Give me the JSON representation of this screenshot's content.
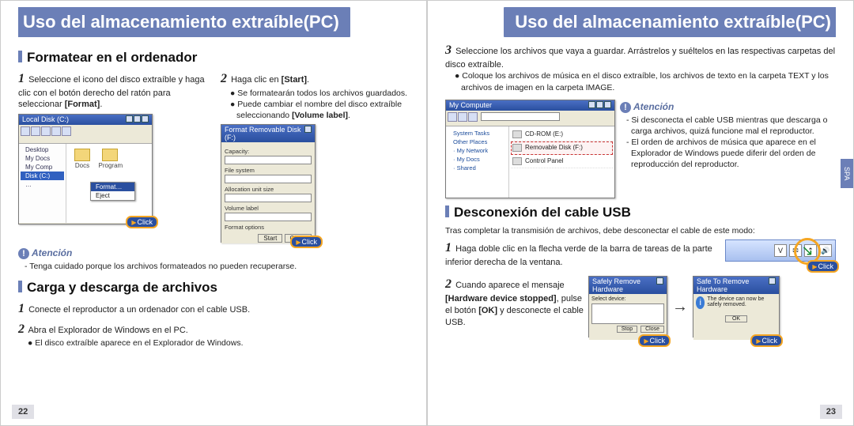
{
  "page_left": {
    "title": "Uso del almacenamiento extraíble(PC)",
    "number": "22",
    "section_format": {
      "heading": "Formatear en el ordenador",
      "step1_prefix": "1",
      "step1": "Seleccione el icono del disco extraíble y haga clic con el botón derecho del ratón para seleccionar ",
      "step1_bold": "[Format]",
      "step1_after": ".",
      "step2_prefix": "2",
      "step2": "Haga clic en ",
      "step2_bold": "[Start]",
      "step2_after": ".",
      "step2_b1": "● Se formatearán todos los archivos guardados.",
      "step2_b2a": "● Puede cambiar el nombre del disco extraíble seleccionando ",
      "step2_b2_bold": "[Volume label]",
      "step2_b2b": ".",
      "atencion": "Atención",
      "aten_line": "- Tenga cuidado porque los archivos formateados no pueden recuperarse."
    },
    "section_cargadescarga": {
      "heading": "Carga y descarga de archivos",
      "step1_prefix": "1",
      "step1": "Conecte el reproductor a un ordenador con el cable USB.",
      "step2_prefix": "2",
      "step2": "Abra el Explorador de Windows en el PC.",
      "step2_b1": "● El disco extraíble aparece en el Explorador de Windows."
    },
    "screenshots": {
      "explorer_title": "Local Disk (C:)",
      "ctx_item_hi": "Format…",
      "ctx_item_2": "Eject",
      "click": "Click",
      "formatdlg_title": "Format  Removable Disk (F:)",
      "lbl_capacity": "Capacity:",
      "lbl_filesystem": "File system",
      "lbl_alloc": "Allocation unit size",
      "lbl_volume": "Volume label",
      "lbl_options": "Format options",
      "btn_start": "Start",
      "btn_close": "Close"
    }
  },
  "page_right": {
    "title": "Uso del almacenamiento extraíble(PC)",
    "number": "23",
    "side_tab": "SPA",
    "cont_step3_prefix": "3",
    "cont_step3": "Seleccione los archivos que vaya a guardar. Arrástrelos y suéltelos en las respectivas carpetas del disco extraíble.",
    "cont_b1": "● Coloque los archivos de música en el disco extraíble, los archivos de texto en la carpeta TEXT y los archivos de imagen en la carpeta IMAGE.",
    "atencion": "Atención",
    "aten_l1": "- Si desconecta el cable USB mientras que descarga o carga archivos, quizá funcione mal el reproductor.",
    "aten_l2": "- El orden de archivos de música que aparece en el Explorador de Windows puede diferir del orden de reproducción del reproductor.",
    "section_desconexion": {
      "heading": "Desconexión del cable USB",
      "intro": "Tras completar la transmisión de archivos, debe desconectar el cable de este modo:",
      "step1_prefix": "1",
      "step1": "Haga doble clic en la flecha verde de la barra de tareas de la parte inferior derecha de la ventana.",
      "step2_prefix": "2",
      "step2a": "Cuando aparece el mensaje ",
      "step2_bold": "[Hardware device stopped]",
      "step2b": ", pulse el botón ",
      "step2_bold2": "[OK]",
      "step2c": " y desconecte el cable USB."
    },
    "screenshots": {
      "explorer_title": "My Computer",
      "row1": "CD-ROM (E:)",
      "row2": "Removable Disk (F:)",
      "row3": "Control Panel",
      "tray_V": "V",
      "tray_E": "✉",
      "click": "Click",
      "stopdlg_title": "Safely Remove Hardware",
      "stopdlg_btn1": "Stop",
      "stopdlg_btn2": "Close",
      "stopdlg2_title": "Safe To Remove Hardware",
      "stopdlg2_msg": "The device can now be safely removed.",
      "stopdlg2_ok": "OK"
    }
  }
}
